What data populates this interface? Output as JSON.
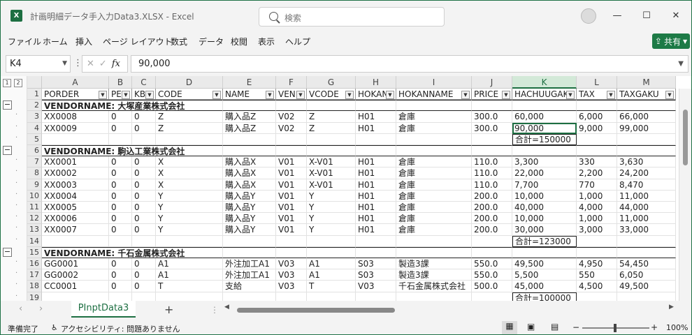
{
  "window": {
    "app_icon": "X",
    "title": "計画明細データ手入力Data3.XLSX  -  Excel",
    "search_placeholder": "検索",
    "minimize": "—",
    "maximize": "☐",
    "close": "✕"
  },
  "menu": [
    "ファイル",
    "ホーム",
    "挿入",
    "ページ レイアウト",
    "数式",
    "データ",
    "校閲",
    "表示",
    "ヘルプ"
  ],
  "share_label": "共有",
  "formula_bar": {
    "name_box": "K4",
    "fx": "fx",
    "value": "90,000"
  },
  "outline_levels": [
    "1",
    "2"
  ],
  "columns": [
    "A",
    "B",
    "C",
    "D",
    "E",
    "F",
    "G",
    "H",
    "I",
    "J",
    "K",
    "L",
    "M"
  ],
  "selected_column": "K",
  "headers": [
    "PORDER",
    "PE",
    "KB",
    "CODE",
    "NAME",
    "VEND",
    "VCODE",
    "HOKAN",
    "HOKANNAME",
    "PRICE",
    "HACHUUGAK",
    "TAX",
    "TAXGAKU"
  ],
  "rows": [
    {
      "n": "2",
      "type": "vendor",
      "text": "VENDORNAME: 大塚産業株式会社"
    },
    {
      "n": "3",
      "type": "data",
      "cells": [
        "XX0008",
        "0",
        "0",
        "Z",
        "購入品Z",
        "V02",
        "Z",
        "H01",
        "倉庫",
        "300.0",
        "60,000",
        "6,000",
        "66,000"
      ]
    },
    {
      "n": "4",
      "type": "data",
      "cells": [
        "XX0009",
        "0",
        "0",
        "Z",
        "購入品Z",
        "V02",
        "Z",
        "H01",
        "倉庫",
        "300.0",
        "90,000",
        "9,000",
        "99,000"
      ]
    },
    {
      "n": "5",
      "type": "total",
      "text": "合計=150000"
    },
    {
      "n": "6",
      "type": "vendor",
      "text": "VENDORNAME: 駒込工業株式会社"
    },
    {
      "n": "7",
      "type": "data",
      "cells": [
        "XX0001",
        "0",
        "0",
        "X",
        "購入品X",
        "V01",
        "X-V01",
        "H01",
        "倉庫",
        "110.0",
        "3,300",
        "330",
        "3,630"
      ]
    },
    {
      "n": "8",
      "type": "data",
      "cells": [
        "XX0002",
        "0",
        "0",
        "X",
        "購入品X",
        "V01",
        "X-V01",
        "H01",
        "倉庫",
        "110.0",
        "22,000",
        "2,200",
        "24,200"
      ]
    },
    {
      "n": "9",
      "type": "data",
      "cells": [
        "XX0003",
        "0",
        "0",
        "X",
        "購入品X",
        "V01",
        "X-V01",
        "H01",
        "倉庫",
        "110.0",
        "7,700",
        "770",
        "8,470"
      ]
    },
    {
      "n": "10",
      "type": "data",
      "cells": [
        "XX0004",
        "0",
        "0",
        "Y",
        "購入品Y",
        "V01",
        "Y",
        "H01",
        "倉庫",
        "200.0",
        "10,000",
        "1,000",
        "11,000"
      ]
    },
    {
      "n": "11",
      "type": "data",
      "cells": [
        "XX0005",
        "0",
        "0",
        "Y",
        "購入品Y",
        "V01",
        "Y",
        "H01",
        "倉庫",
        "200.0",
        "40,000",
        "4,000",
        "44,000"
      ]
    },
    {
      "n": "12",
      "type": "data",
      "cells": [
        "XX0006",
        "0",
        "0",
        "Y",
        "購入品Y",
        "V01",
        "Y",
        "H01",
        "倉庫",
        "200.0",
        "10,000",
        "1,000",
        "11,000"
      ]
    },
    {
      "n": "13",
      "type": "data",
      "cells": [
        "XX0007",
        "0",
        "0",
        "Y",
        "購入品Y",
        "V01",
        "Y",
        "H01",
        "倉庫",
        "200.0",
        "30,000",
        "3,000",
        "33,000"
      ]
    },
    {
      "n": "14",
      "type": "total",
      "text": "合計=123000"
    },
    {
      "n": "15",
      "type": "vendor",
      "text": "VENDORNAME: 千石金属株式会社"
    },
    {
      "n": "16",
      "type": "data",
      "cells": [
        "GG0001",
        "0",
        "0",
        "A1",
        "外注加工A1",
        "V03",
        "A1",
        "S03",
        "製造3課",
        "550.0",
        "49,500",
        "4,950",
        "54,450"
      ]
    },
    {
      "n": "17",
      "type": "data",
      "cells": [
        "GG0002",
        "0",
        "0",
        "A1",
        "外注加工A1",
        "V03",
        "A1",
        "S03",
        "製造3課",
        "550.0",
        "5,500",
        "550",
        "6,050"
      ]
    },
    {
      "n": "18",
      "type": "data",
      "cells": [
        "CC0001",
        "0",
        "0",
        "T",
        "支給",
        "V03",
        "T",
        "V03",
        "千石金属株式会社",
        "500.0",
        "45,000",
        "4,500",
        "49,500"
      ]
    },
    {
      "n": "19",
      "type": "total",
      "text": "合計=100000"
    }
  ],
  "sheet_tab": "PInptData3",
  "add_sheet": "+",
  "status": {
    "ready": "準備完了",
    "accessibility": "アクセシビリティ: 問題ありません",
    "zoom": "100%"
  }
}
